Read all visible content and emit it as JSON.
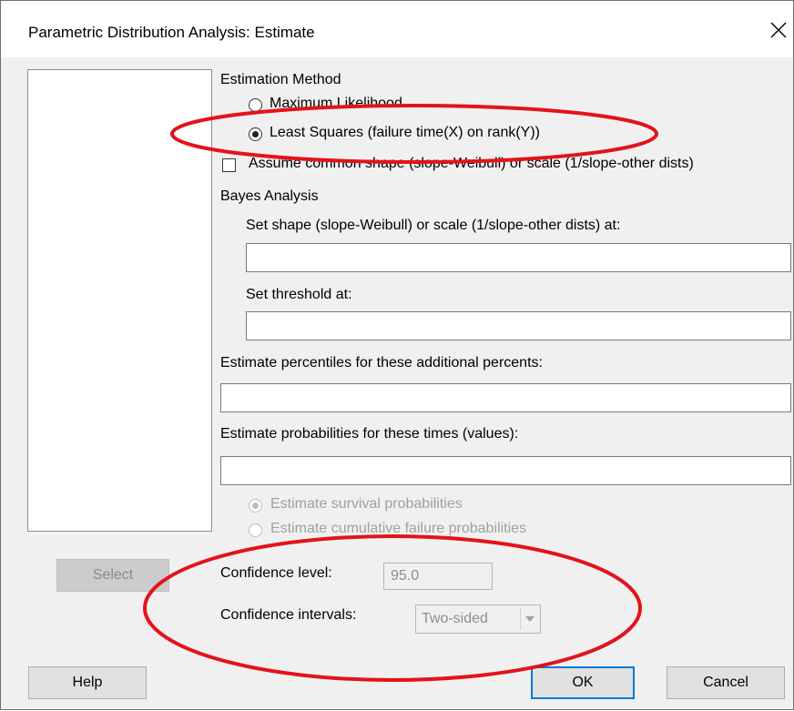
{
  "window": {
    "title": "Parametric Distribution Analysis: Estimate",
    "close_label": "Close"
  },
  "estimation": {
    "heading": "Estimation Method",
    "option_ml": "Maximum Likelihood",
    "option_ls": "Least Squares (failure time(X) on rank(Y))",
    "selected": "Least Squares (failure time(X) on rank(Y))",
    "assume_common": "Assume common shape (slope-Weibull) or scale (1/slope-other dists)",
    "assume_common_checked": false
  },
  "bayes": {
    "heading": "Bayes Analysis",
    "shape_label": "Set shape (slope-Weibull) or scale (1/slope-other dists) at:",
    "shape_value": "",
    "threshold_label": "Set threshold at:",
    "threshold_value": ""
  },
  "percentiles": {
    "label": "Estimate percentiles for these additional percents:",
    "value": ""
  },
  "probabilities": {
    "label": "Estimate probabilities for these times (values):",
    "value": "",
    "option_survival": "Estimate survival probabilities",
    "option_cumulative": "Estimate cumulative failure probabilities",
    "selected": "Estimate survival probabilities"
  },
  "confidence": {
    "level_label": "Confidence level:",
    "level_value": "95.0",
    "intervals_label": "Confidence intervals:",
    "intervals_value": "Two-sided"
  },
  "buttons": {
    "select": "Select",
    "help": "Help",
    "ok": "OK",
    "cancel": "Cancel"
  },
  "colors": {
    "annotation": "#e3131b",
    "dialog_bg": "#f0f0f0",
    "focus_border": "#0078d7"
  }
}
